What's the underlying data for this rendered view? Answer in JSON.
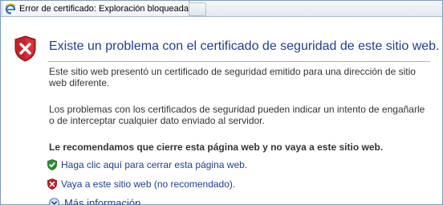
{
  "tab": {
    "title": "Error de certificado: Exploración bloqueada",
    "icon": "internet-explorer-icon"
  },
  "page": {
    "heading": "Existe un problema con el certificado de seguridad de este sitio web.",
    "heading_icon": "red-shield-x-icon",
    "paragraph_1": "Este sitio web presentó un certificado de seguridad emitido para una dirección de sitio web diferente.",
    "paragraph_2": "Los problemas con los certificados de seguridad pueden indicar un intento de engañarle o de interceptar cualquier dato enviado al servidor.",
    "recommendation": "Le recomendamos que cierre esta página web y no vaya a este sitio web.",
    "close_link": "Haga clic aquí para cerrar esta página web.",
    "close_link_icon": "green-shield-check-icon",
    "continue_link": "Vaya a este sitio web (no recomendado).",
    "continue_link_icon": "red-shield-x-icon",
    "more_info": "Más información",
    "more_info_icon": "chevron-down-circle-icon"
  },
  "colors": {
    "heading": "#1f3f8f",
    "link": "#1f3f8f",
    "body_text": "#333333",
    "rule": "#9fb6d4",
    "danger": "#c8202a",
    "safe": "#2f8f2f"
  }
}
